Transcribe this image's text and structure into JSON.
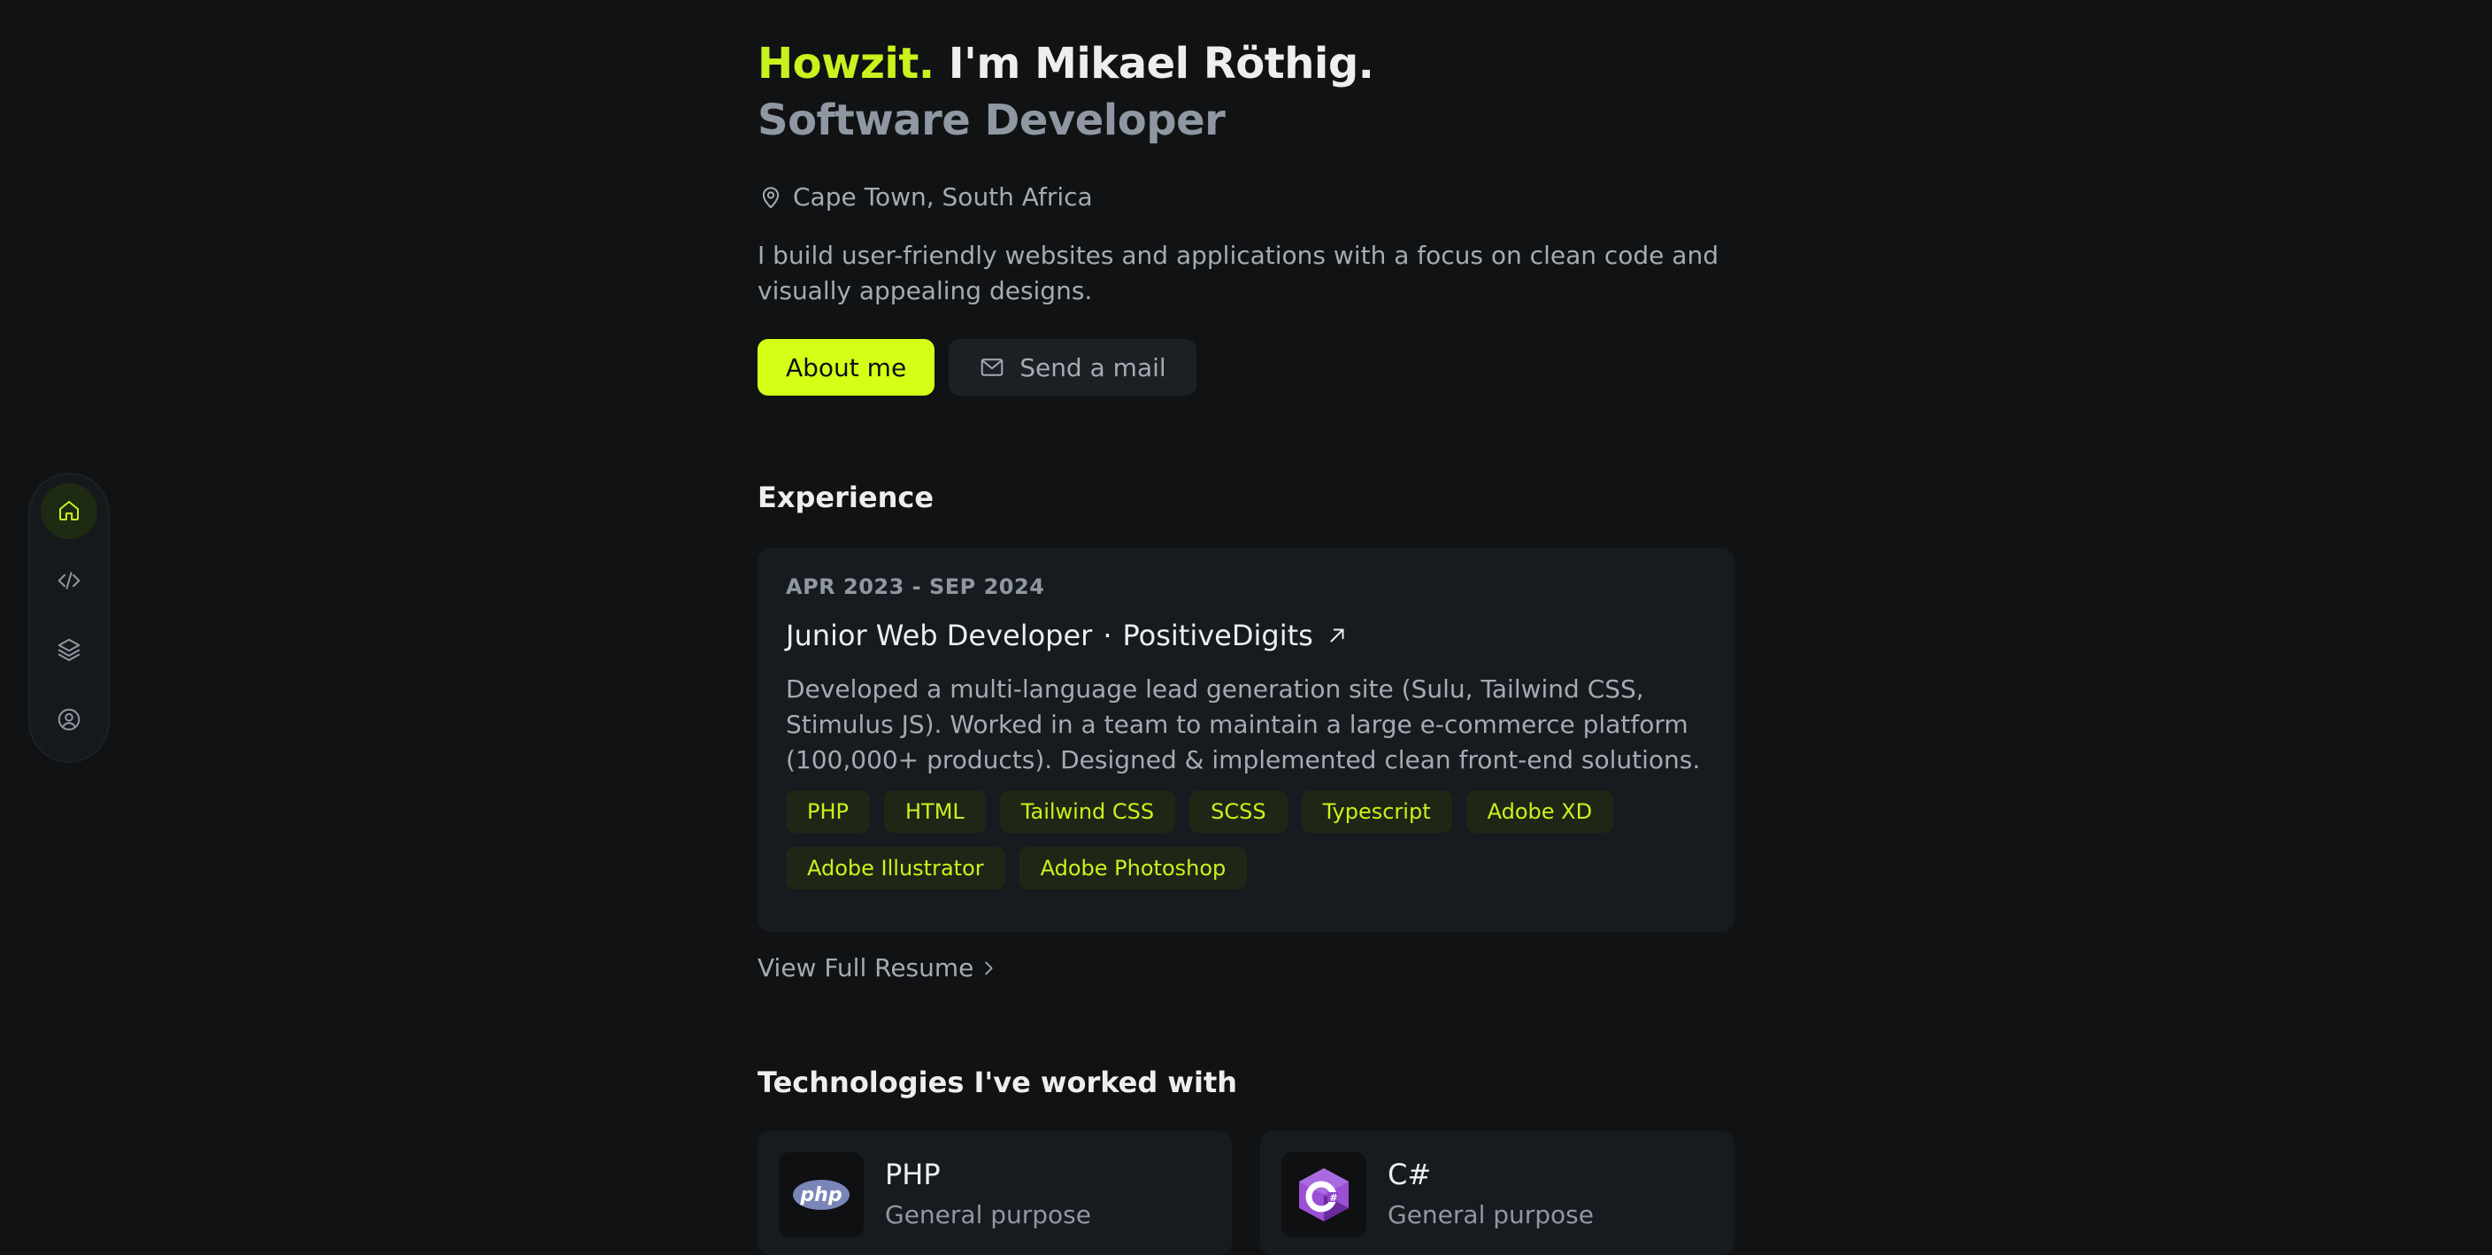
{
  "dock": {
    "items": [
      {
        "icon": "home-icon",
        "active": true
      },
      {
        "icon": "code-icon",
        "active": false
      },
      {
        "icon": "layers-icon",
        "active": false
      },
      {
        "icon": "user-circle-icon",
        "active": false
      }
    ]
  },
  "hero": {
    "greeting": "Howzit.",
    "name": "I'm Mikael Röthig.",
    "role": "Software Developer",
    "location": "Cape Town, South Africa",
    "intro": "I build user-friendly websites and applications with a focus on clean code and visually appealing designs.",
    "primary_button": "About me",
    "secondary_button": "Send a mail"
  },
  "experience": {
    "title": "Experience",
    "job": {
      "date": "APR 2023 - SEP 2024",
      "role": "Junior Web Developer",
      "separator": "·",
      "company": "PositiveDigits",
      "description": "Developed a multi-language lead generation site (Sulu, Tailwind CSS, Stimulus JS). Worked in a team to maintain a large e-commerce platform (100,000+ products). Designed & implemented clean front-end solutions.",
      "tags": [
        "PHP",
        "HTML",
        "Tailwind CSS",
        "SCSS",
        "Typescript",
        "Adobe XD",
        "Adobe Illustrator",
        "Adobe Photoshop"
      ]
    },
    "resume_link": "View Full Resume"
  },
  "technologies": {
    "title": "Technologies I've worked with",
    "items": [
      {
        "name": "PHP",
        "kind": "General purpose",
        "logo_text": "php"
      },
      {
        "name": "C#",
        "kind": "General purpose",
        "logo_text": "C#"
      }
    ]
  },
  "colors": {
    "accent": "#d4ff17",
    "background": "#101214",
    "card": "#171a1e"
  }
}
